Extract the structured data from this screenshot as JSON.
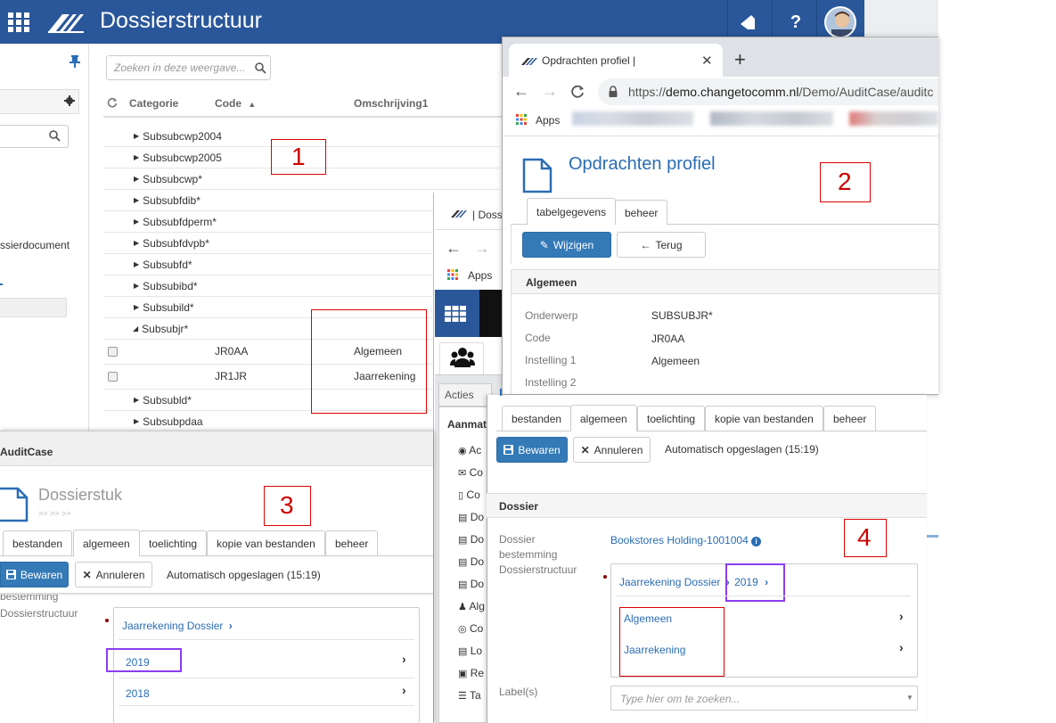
{
  "topbar": {
    "title": "Dossierstructuur",
    "bg": "#2a579a"
  },
  "left_panel": {
    "partial_text": "ssierdocument"
  },
  "search": {
    "placeholder": "Zoeken in deze weergave..."
  },
  "table": {
    "headers": [
      "Categorie",
      "Code",
      "Omschrijving1"
    ],
    "tree_rows": [
      "Subsubcwp2004",
      "Subsubcwp2005",
      "Subsubcwp*",
      "Subsubfdib*",
      "Subsubfdperm*",
      "Subsubfdvpb*",
      "Subsubfd*",
      "Subsubibd*",
      "Subsubild*",
      "Subsubjr*"
    ],
    "child_rows": [
      {
        "code": "JR0AA",
        "desc": "Algemeen"
      },
      {
        "code": "JR1JR",
        "desc": "Jaarrekening"
      }
    ],
    "after_rows": [
      "Subsubld*",
      "Subsubpdaa"
    ]
  },
  "annotations": {
    "n1": "1",
    "n2": "2",
    "n3": "3",
    "n4": "4"
  },
  "browser": {
    "tab_title": "Opdrachten profiel |",
    "url_prefix": "https://",
    "url_host": "demo.changetocomm.nl",
    "url_path": "/Demo/AuditCase/auditc",
    "apps_label": "Apps",
    "page_title": "Opdrachten profiel",
    "tabs": [
      "tabelgegevens",
      "beheer"
    ],
    "btn_edit": "Wijzigen",
    "btn_back": "Terug",
    "section": "Algemeen",
    "fields": [
      {
        "label": "Onderwerp",
        "value": "SUBSUBJR*"
      },
      {
        "label": "Code",
        "value": "JR0AA"
      },
      {
        "label": "Instelling 1",
        "value": "Algemeen"
      },
      {
        "label": "Instelling 2",
        "value": ""
      }
    ]
  },
  "browser2": {
    "tab_title": "| Doss",
    "apps_label": "Apps",
    "acties": "Acties",
    "aanmat": "Aanmat",
    "menu_items": [
      "Ac",
      "Co",
      "Co",
      "Do",
      "Do",
      "Do",
      "Do",
      "Alg",
      "Co",
      "Lo",
      "Re",
      "Ta"
    ]
  },
  "window3": {
    "app": "AuditCase",
    "title": "Dossierstuk",
    "crumb": ">> >> >>",
    "tabs": [
      "bestanden",
      "algemeen",
      "toelichting",
      "kopie van bestanden",
      "beheer"
    ],
    "save": "Bewaren",
    "cancel": "Annuleren",
    "autosave": "Automatisch opgeslagen (15:19)",
    "label_a": "bestemming",
    "label_b": "Dossierstructuur",
    "crumb_link": "Jaarrekening Dossier",
    "items": [
      "2019",
      "2018"
    ]
  },
  "window4": {
    "tabs": [
      "bestanden",
      "algemeen",
      "toelichting",
      "kopie van bestanden",
      "beheer"
    ],
    "save": "Bewaren",
    "cancel": "Annuleren",
    "autosave": "Automatisch opgeslagen (15:19)",
    "section": "Dossier",
    "label_dossier": "Dossier",
    "dossier_value": "Bookstores Holding-1001004",
    "label_bestemming": "bestemming",
    "label_structuur": "Dossierstructuur",
    "crumb_link": "Jaarrekening Dossier",
    "crumb_year": "2019",
    "items": [
      "Algemeen",
      "Jaarrekening"
    ],
    "labels_label": "Label(s)",
    "labels_placeholder": "Type hier om te zoeken..."
  }
}
